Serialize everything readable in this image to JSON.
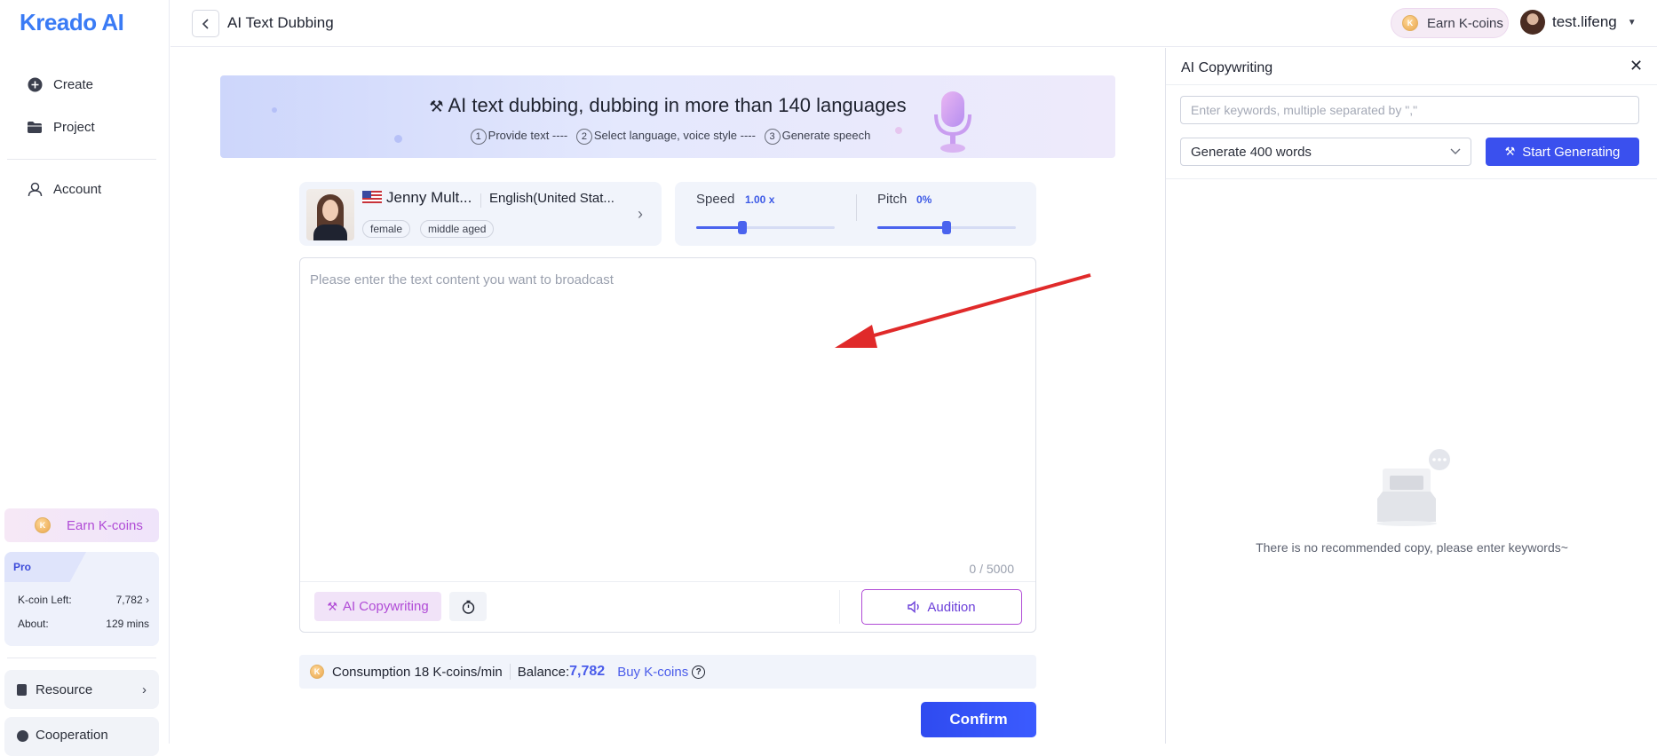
{
  "brand": {
    "logo_text": "Kreado",
    "logo_ai": "AI"
  },
  "sidebar": {
    "nav": [
      {
        "label": "Create",
        "icon": "plus-circle-icon"
      },
      {
        "label": "Project",
        "icon": "folder-icon"
      },
      {
        "label": "Account",
        "icon": "user-icon"
      }
    ],
    "earn_label": "Earn K-coins",
    "pro": {
      "tag": "Pro",
      "kcoin_left_label": "K-coin Left:",
      "kcoin_left_value": "7,782",
      "about_label": "About:",
      "about_value": "129 mins"
    },
    "resource_label": "Resource",
    "cooperation_label": "Cooperation"
  },
  "header": {
    "title": "AI Text Dubbing",
    "earn_label": "Earn K-coins",
    "username": "test.lifeng"
  },
  "banner": {
    "title": "AI text dubbing, dubbing in more than 140 languages",
    "steps": [
      {
        "num": "1",
        "text": "Provide text ----"
      },
      {
        "num": "2",
        "text": "Select language, voice style ----"
      },
      {
        "num": "3",
        "text": "Generate speech"
      }
    ]
  },
  "voice": {
    "name": "Jenny Mult...",
    "language": "English(United Stat...",
    "tags": [
      "female",
      "middle aged"
    ]
  },
  "sliders": {
    "speed_label": "Speed",
    "speed_value": "1.00 x",
    "speed_level": 0.33,
    "pitch_label": "Pitch",
    "pitch_value": "0%",
    "pitch_level": 0.5
  },
  "editor": {
    "placeholder": "Please enter the text content you want to broadcast",
    "counter": "0 / 5000",
    "ai_copy_label": "AI Copywriting",
    "audition_label": "Audition"
  },
  "consumption": {
    "text": "Consumption 18 K-coins/min",
    "balance_label": "Balance:",
    "balance_value": "7,782",
    "buy_label": "Buy K-coins"
  },
  "confirm_label": "Confirm",
  "right_panel": {
    "title": "AI Copywriting",
    "keyword_placeholder": "Enter keywords, multiple separated by \",\"",
    "word_count": "Generate 400 words",
    "start_label": "Start Generating",
    "empty_text": "There is no recommended copy, please enter keywords~"
  },
  "colors": {
    "accent": "#3a50ee",
    "purple": "#b04bd6",
    "annotation_arrow": "#e02a2a"
  }
}
